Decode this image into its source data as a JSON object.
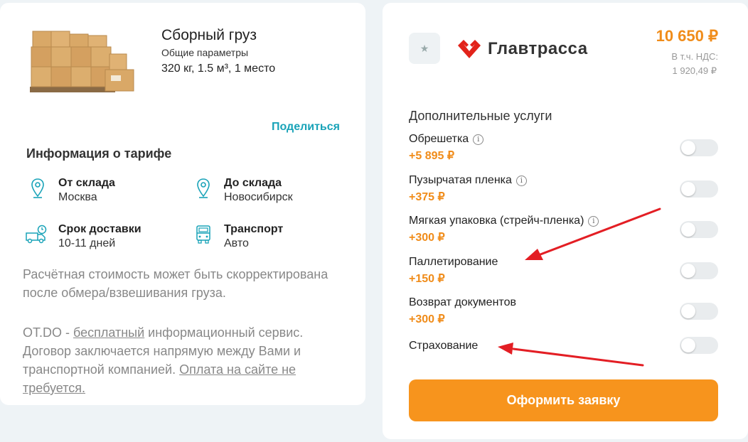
{
  "cargo": {
    "title": "Сборный груз",
    "subtitle": "Общие параметры",
    "params": "320 кг, 1.5 м³, 1 место",
    "image_icon": "cardboard-boxes-on-pallet"
  },
  "share_label": "Поделиться",
  "tariff": {
    "heading": "Информация о тарифе",
    "from": {
      "label": "От склада",
      "value": "Москва",
      "icon": "location-pin-icon"
    },
    "to": {
      "label": "До склада",
      "value": "Новосибирск",
      "icon": "location-pin-icon"
    },
    "delivery": {
      "label": "Срок доставки",
      "value": "10-11 дней",
      "icon": "truck-clock-icon"
    },
    "transport": {
      "label": "Транспорт",
      "value": "Авто",
      "icon": "truck-front-icon"
    }
  },
  "note": {
    "estimate": "Расчётная стоимость может быть скорректирована после обмера/взвешивания груза.",
    "service_prefix": "OT.DO - ",
    "free": "бесплатный",
    "service_mid": " информационный сервис. Договор заключается напрямую между Вами и транспортной компанией. ",
    "no_pay": "Оплата на сайте не требуется."
  },
  "offer": {
    "carrier": "Главтрасса",
    "price": "10 650 ₽",
    "vat_label": "В т.ч. НДС:",
    "vat_value": "1 920,49 ₽",
    "accent": "#f08c1a",
    "logo_color": "#e2231a"
  },
  "services": {
    "heading": "Дополнительные услуги",
    "items": [
      {
        "name": "Обрешетка",
        "price": "+5 895 ₽",
        "info": true,
        "enabled": false
      },
      {
        "name": "Пузырчатая пленка",
        "price": "+375 ₽",
        "info": true,
        "enabled": false
      },
      {
        "name": "Мягкая упаковка (стрейч-пленка)",
        "price": "+300 ₽",
        "info": true,
        "enabled": false
      },
      {
        "name": "Паллетирование",
        "price": "+150 ₽",
        "info": false,
        "enabled": false
      },
      {
        "name": "Возврат документов",
        "price": "+300 ₽",
        "info": false,
        "enabled": false
      },
      {
        "name": "Страхование",
        "price": "",
        "info": false,
        "enabled": false
      }
    ]
  },
  "order_button": "Оформить заявку",
  "annotation_color": "#e31e24"
}
